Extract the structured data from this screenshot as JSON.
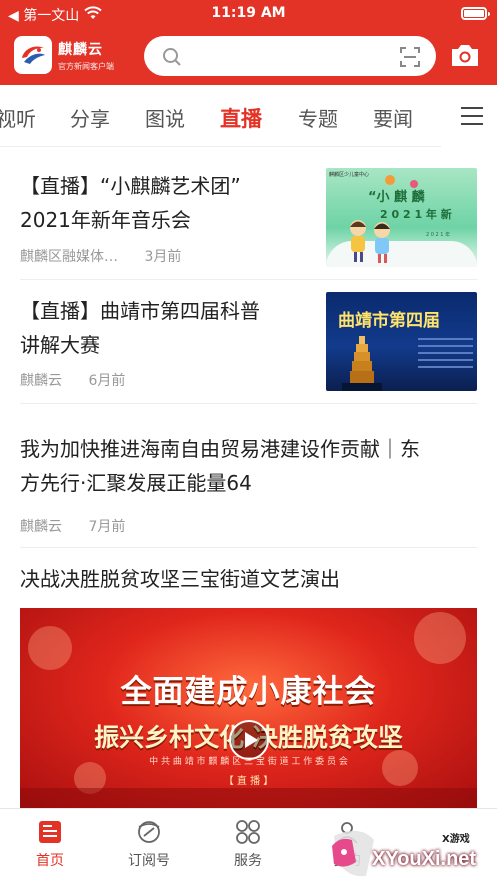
{
  "status_bar": {
    "back_carrier": "◀ 第一文山",
    "time": "11:19 AM"
  },
  "header": {
    "app_name": "麒麟云",
    "slogan": "官方新闻客户端"
  },
  "tabs": [
    "视听",
    "分享",
    "图说",
    "直播",
    "专题",
    "要闻",
    "t"
  ],
  "active_tab": "直播",
  "feed": [
    {
      "title_line1": "【直播】“小麒麟艺术团”",
      "title_line2": "2021年新年音乐会",
      "source": "麒麟区融媒体…",
      "ago": "3月前",
      "thumb": {
        "header_text": "麒麟区少儿童中心",
        "quote_title": "“小 麒 麟",
        "year_line": "2 0 2 1 年 新",
        "caption": "2 0 2 1 年"
      }
    },
    {
      "title_line1": "【直播】曲靖市第四届科普",
      "title_line2": "讲解大赛",
      "source": "麒麟云",
      "ago": "6月前",
      "thumb": {
        "headline": "曲靖市第四届"
      }
    },
    {
      "title_line1": "我为加快推进海南自由贸易港建设作贡献｜东",
      "title_line2": "方先行·汇聚发展正能量64",
      "source": "麒麟云",
      "ago": "7月前"
    },
    {
      "title": "决战决胜脱贫攻坚三宝街道文艺演出",
      "poster": {
        "line1": "全面建成小康社会",
        "line2": "振兴乡村文化  决胜脱贫攻坚",
        "org": "中 共 曲 靖 市 麒 麟 区 三 宝 街 道 工 作 委 员 会",
        "tag": "【 直 播 】"
      }
    }
  ],
  "bottom_nav": [
    {
      "label": "首页",
      "icon": "home-news-icon",
      "active": true
    },
    {
      "label": "订阅号",
      "icon": "subscribe-icon",
      "active": false
    },
    {
      "label": "服务",
      "icon": "services-grid-icon",
      "active": false
    },
    {
      "label": "我的",
      "icon": "profile-icon",
      "active": false
    }
  ],
  "watermark": {
    "site": "XYouXi.net",
    "tag": "X游戏"
  },
  "colors": {
    "brand_red": "#e33226",
    "text_primary": "#222222",
    "text_meta": "#999999"
  }
}
